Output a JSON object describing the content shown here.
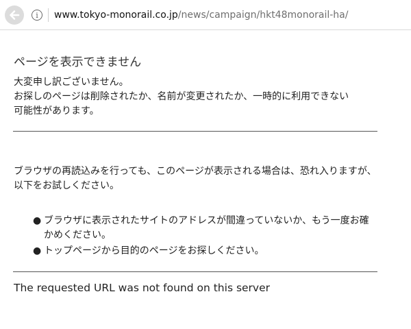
{
  "browser": {
    "back_icon": "arrow-left-icon",
    "info_icon_glyph": "i",
    "url_host": "www.tokyo-monorail.co.jp",
    "url_path": "/news/campaign/hkt48monorail-ha/"
  },
  "error_page": {
    "heading": "ページを表示できません",
    "apology": "大変申し訳ございません。",
    "explanation_line1": "お探しのページは削除されたか、名前が変更されたか、一時的に利用できない",
    "explanation_line2": "可能性があります。",
    "advice": "ブラウザの再読込みを行っても、このページが表示される場合は、恐れ入りますが、以下をお試しください。",
    "tips": [
      "ブラウザに表示されたサイトのアドレスが間違っていないか、もう一度お確かめください。",
      "トップページから目的のページをお探しください。"
    ],
    "bullet": "●",
    "footer": "The requested URL was not found on this server"
  }
}
